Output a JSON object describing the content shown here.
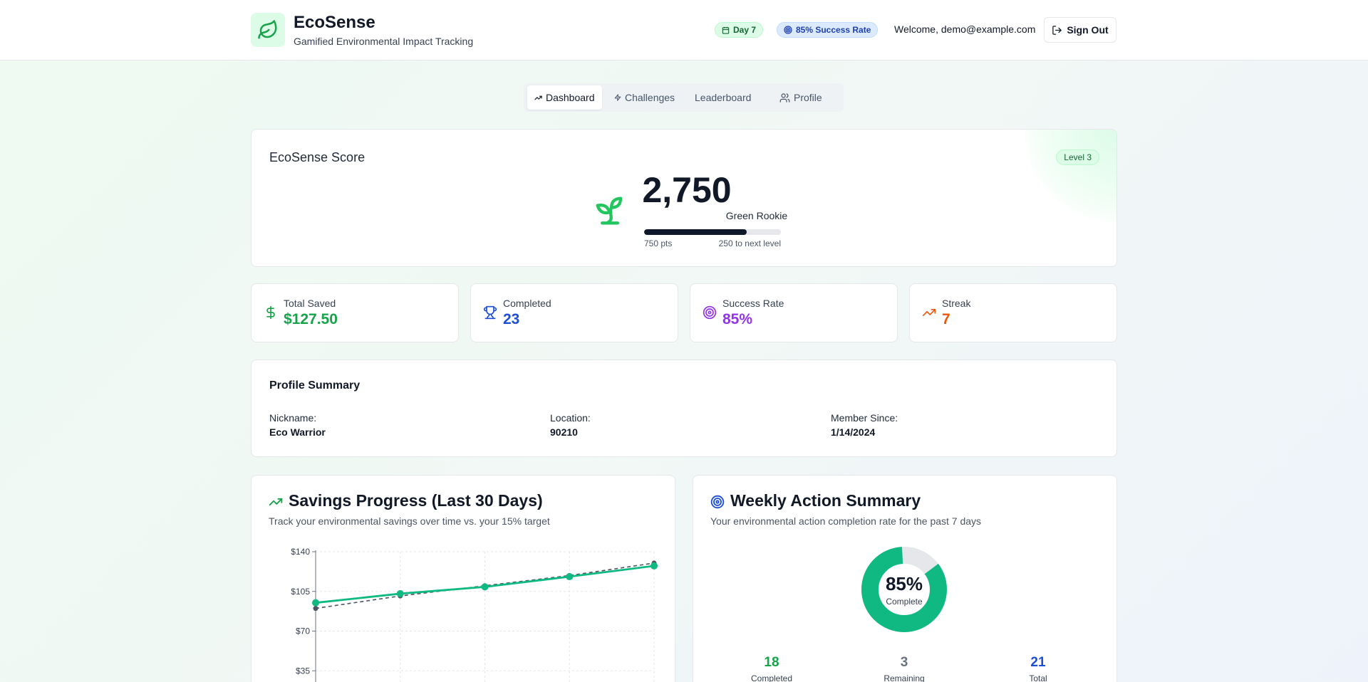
{
  "header": {
    "app_title": "EcoSense",
    "app_subtitle": "Gamified Environmental Impact Tracking",
    "day_badge": "Day 7",
    "rate_badge": "85% Success Rate",
    "welcome": "Welcome, demo@example.com",
    "signout_label": "Sign Out"
  },
  "tabs": [
    {
      "label": "Dashboard",
      "icon": "trending-up-icon",
      "active": true
    },
    {
      "label": "Challenges",
      "icon": "zap-icon",
      "active": false
    },
    {
      "label": "Leaderboard",
      "icon": "",
      "active": false
    },
    {
      "label": "Profile",
      "icon": "users-icon",
      "active": false
    }
  ],
  "score": {
    "label": "EcoSense Score",
    "level": "Level 3",
    "value": "2,750",
    "rank": "Green Rookie",
    "progress_fraction": 0.75,
    "points_label": "750 pts",
    "next_label": "250 to next level"
  },
  "stats": [
    {
      "label": "Total Saved",
      "value": "$127.50",
      "icon": "dollar-icon",
      "color": "#16a34a"
    },
    {
      "label": "Completed",
      "value": "23",
      "icon": "trophy-icon",
      "color": "#1d4ed8"
    },
    {
      "label": "Success Rate",
      "value": "85%",
      "icon": "target-icon",
      "color": "#9333ea"
    },
    {
      "label": "Streak",
      "value": "7",
      "icon": "trending-up-icon",
      "color": "#ea580c"
    }
  ],
  "profile": {
    "title": "Profile Summary",
    "nickname_label": "Nickname:",
    "nickname": "Eco Warrior",
    "location_label": "Location:",
    "location": "90210",
    "member_label": "Member Since:",
    "member_since": "1/14/2024"
  },
  "savings": {
    "title": "Savings Progress (Last 30 Days)",
    "subtitle": "Track your environmental savings over time vs. your 15% target"
  },
  "chart_data": {
    "type": "line",
    "x": [
      1,
      2,
      3,
      4,
      5
    ],
    "ylim": [
      0,
      140
    ],
    "yticks": [
      140,
      105,
      70,
      35
    ],
    "ytick_labels": [
      "$140",
      "$105",
      "$70",
      "$35"
    ],
    "grid": true,
    "series": [
      {
        "values": [
          95,
          103,
          109,
          118,
          127.5
        ],
        "color": "#10b981",
        "style": "solid"
      },
      {
        "values": [
          90,
          101,
          110,
          119,
          130
        ],
        "color": "#4b5563",
        "style": "dashed"
      }
    ]
  },
  "weekly": {
    "title": "Weekly Action Summary",
    "subtitle": "Your environmental action completion rate for the past 7 days",
    "percent": "85%",
    "percent_value": 0.85,
    "center_label": "Complete",
    "completed": "18",
    "completed_label": "Completed",
    "remaining": "3",
    "remaining_label": "Remaining",
    "total": "21",
    "total_label": "Total"
  },
  "colors": {
    "accent_green": "#10b981",
    "brand_green": "#16a34a"
  }
}
